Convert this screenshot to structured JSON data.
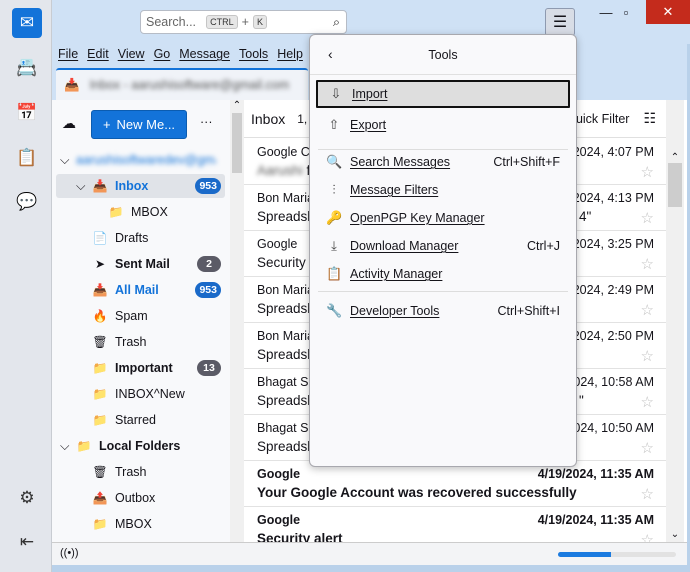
{
  "spaces": [
    {
      "name": "mail",
      "icon": "✉"
    },
    {
      "name": "address-book",
      "icon": "📇"
    },
    {
      "name": "calendar",
      "icon": "📅"
    },
    {
      "name": "tasks",
      "icon": "📋"
    },
    {
      "name": "chat",
      "icon": "💬"
    }
  ],
  "search": {
    "placeholder": "Search...",
    "key1": "CTRL",
    "plus": "+",
    "key2": "K"
  },
  "menubar": [
    "File",
    "Edit",
    "View",
    "Go",
    "Message",
    "Tools",
    "Help"
  ],
  "tab": {
    "title": "Inbox - aarushisoftware@gmail.com"
  },
  "folders": {
    "new_message": "New Me...",
    "account": "aarushisoftwaredev@gmail.com",
    "items": [
      {
        "label": "Inbox",
        "icon": "📥",
        "count": "953",
        "bold": true,
        "blue": true
      },
      {
        "label": "MBOX",
        "icon": "📁"
      },
      {
        "label": "Drafts",
        "icon": "📄"
      },
      {
        "label": "Sent Mail",
        "icon": "➤",
        "count": "2",
        "bold": true
      },
      {
        "label": "All Mail",
        "icon": "📥",
        "count": "953",
        "bold": true,
        "blue": true
      },
      {
        "label": "Spam",
        "icon": "🔥"
      },
      {
        "label": "Trash",
        "icon": "🗑"
      },
      {
        "label": "Important",
        "icon": "📁",
        "count": "13",
        "bold": true
      },
      {
        "label": "INBOX^New",
        "icon": "📁"
      },
      {
        "label": "Starred",
        "icon": "📁"
      },
      {
        "label": "Local Folders",
        "icon": "📁",
        "bold": true
      },
      {
        "label": "Trash",
        "icon": "🗑"
      },
      {
        "label": "Outbox",
        "icon": "📤"
      },
      {
        "label": "MBOX",
        "icon": "📁"
      }
    ]
  },
  "list": {
    "title": "Inbox",
    "count": "1,",
    "quick_filter": "uick Filter",
    "messages": [
      {
        "sender": "Google Co",
        "date": "2/2024, 4:07 PM",
        "subject": "fi",
        "blur": "Aarushi"
      },
      {
        "sender": "Bon Maria",
        "date": "2/2024, 4:13 PM",
        "subject": "Spreadsh",
        "tail": "4\""
      },
      {
        "sender": "Google",
        "date": "/2024, 3:25 PM",
        "subject": "Security a"
      },
      {
        "sender": "Bon Maria",
        "date": "7/2024, 2:49 PM",
        "subject": "Spreadsh"
      },
      {
        "sender": "Bon Maria",
        "date": "7/2024, 2:50 PM",
        "subject": "Spreadsh"
      },
      {
        "sender": "Bhagat Si",
        "date": "2024, 10:58 AM",
        "subject": "Spreadsh",
        "tail": "\""
      },
      {
        "sender": "Bhagat Si",
        "date": "2024, 10:50 AM",
        "subject": "Spreadsh"
      },
      {
        "sender": "Google",
        "date": "4/19/2024, 11:35 AM",
        "subject": "Your Google Account was recovered successfully",
        "bold": true
      },
      {
        "sender": "Google",
        "date": "4/19/2024, 11:35 AM",
        "subject": "Security alert",
        "bold": true
      }
    ]
  },
  "status": {
    "progress": 0.45
  },
  "tools_menu": {
    "title": "Tools",
    "items": [
      {
        "label": "Import",
        "icon": "⇩",
        "shortcut": "",
        "focused": true
      },
      {
        "label": "Export",
        "icon": "⇧",
        "shortcut": ""
      },
      {
        "label": "Search Messages",
        "icon": "🔍",
        "shortcut": "Ctrl+Shift+F"
      },
      {
        "label": "Message Filters",
        "icon": "⫶",
        "shortcut": ""
      },
      {
        "label": "OpenPGP Key Manager",
        "icon": "🔑",
        "shortcut": ""
      },
      {
        "label": "Download Manager",
        "icon": "⤓",
        "shortcut": "Ctrl+J"
      },
      {
        "label": "Activity Manager",
        "icon": "📋",
        "shortcut": ""
      },
      {
        "label": "Developer Tools",
        "icon": "🔧",
        "shortcut": "Ctrl+Shift+I"
      }
    ]
  },
  "colors": {
    "accent": "#1373d9",
    "close": "#c42b1c"
  }
}
